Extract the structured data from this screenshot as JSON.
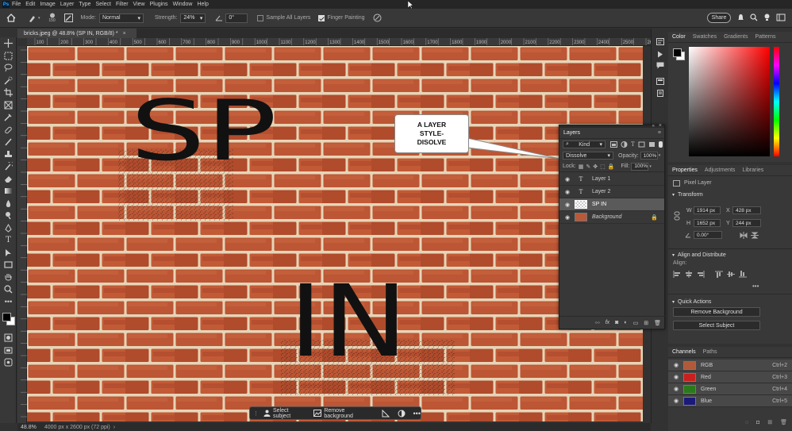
{
  "menubar": {
    "logo": "Ps",
    "items": [
      "File",
      "Edit",
      "Image",
      "Layer",
      "Type",
      "Select",
      "Filter",
      "View",
      "Plugins",
      "Window",
      "Help"
    ]
  },
  "options": {
    "brush_size": "150",
    "mode_label": "Mode:",
    "mode_value": "Normal",
    "strength_label": "Strength:",
    "strength_value": "24%",
    "angle_value": "0°",
    "sample_all_layers": "Sample All Layers",
    "finger_painting": "Finger Painting",
    "share": "Share"
  },
  "document": {
    "tab_title": "bricks.jpeg @ 48.8% (SP IN, RGB/8) *",
    "zoom": "48.8%",
    "dimensions": "4000 px x 2600 px (72 ppi)",
    "ruler_ticks": [
      "100",
      "150",
      "200",
      "250",
      "300",
      "350",
      "400",
      "450",
      "500",
      "550",
      "600",
      "650",
      "700",
      "750",
      "800",
      "850",
      "900",
      "950",
      "1000",
      "1050",
      "1100",
      "1150",
      "1200",
      "1250",
      "1300",
      "1350",
      "1400",
      "1450",
      "1500",
      "1550",
      "1600",
      "1650",
      "1700",
      "1750",
      "1800",
      "1850",
      "1900",
      "1950",
      "2000",
      "2050",
      "2100",
      "2150",
      "2200",
      "2250",
      "2300",
      "2350",
      "2400",
      "2450",
      "2500",
      "2550",
      "2600"
    ],
    "text_top": "SP",
    "text_bottom": "IN"
  },
  "callout": {
    "lines": [
      "A LAYER",
      "STYLE-",
      "DISOLVE"
    ]
  },
  "context_bar": {
    "select_subject": "Select subject",
    "remove_background": "Remove background"
  },
  "color_panel": {
    "tabs": [
      "Color",
      "Swatches",
      "Gradients",
      "Patterns"
    ],
    "fg": "#000000",
    "bg": "#ffffff",
    "hue": "#ff0000"
  },
  "properties": {
    "tabs": [
      "Properties",
      "Adjustments",
      "Libraries"
    ],
    "kind": "Pixel Layer",
    "transform": "Transform",
    "w_label": "W",
    "w": "1914 px",
    "h_label": "H",
    "h": "1652 px",
    "x_label": "X",
    "x": "428 px",
    "y_label": "Y",
    "y": "244 px",
    "angle": "0.00°",
    "align": "Align and Distribute",
    "align_sub": "Align:",
    "quick_actions": "Quick Actions",
    "remove_bg": "Remove Background",
    "select_subject": "Select Subject"
  },
  "channels": {
    "tabs": [
      "Channels",
      "Paths"
    ],
    "items": [
      {
        "name": "RGB",
        "shortcut": "Ctrl+2",
        "color": "#b05a3a"
      },
      {
        "name": "Red",
        "shortcut": "Ctrl+3",
        "color": "#c8201c"
      },
      {
        "name": "Green",
        "shortcut": "Ctrl+4",
        "color": "#2a7a1a"
      },
      {
        "name": "Blue",
        "shortcut": "Ctrl+5",
        "color": "#1a1a7a"
      }
    ]
  },
  "layers": {
    "title": "Layers",
    "filter": "Kind",
    "blend": "Dissolve",
    "opacity_label": "Opacity:",
    "opacity": "100%",
    "lock_label": "Lock:",
    "fill_label": "Fill:",
    "fill": "100%",
    "items": [
      {
        "name": "Layer 1",
        "type": "T"
      },
      {
        "name": "Layer 2",
        "type": "T"
      },
      {
        "name": "SP IN",
        "type": "pixel"
      },
      {
        "name": "Background",
        "type": "bg"
      }
    ]
  }
}
